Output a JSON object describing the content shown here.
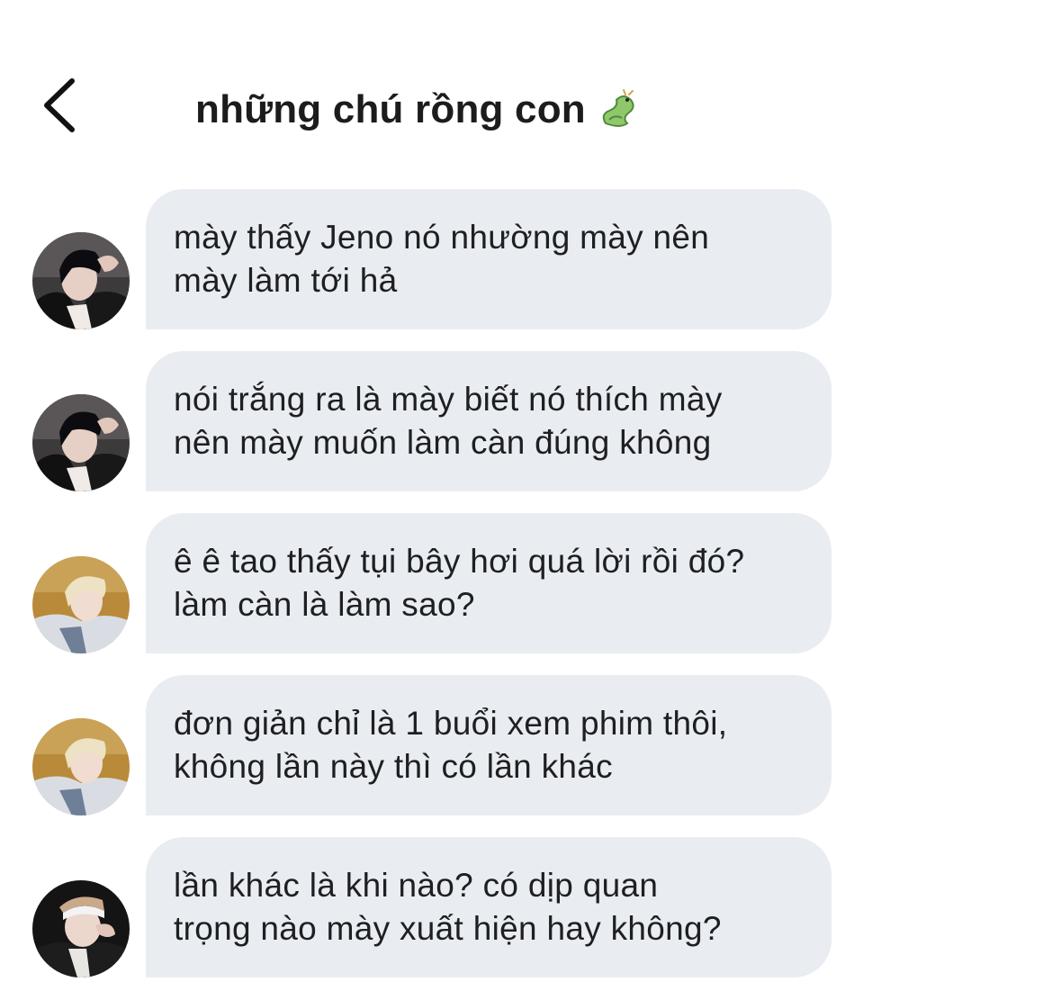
{
  "header": {
    "title": "những chú rồng con",
    "title_emoji": "dragon-emoji",
    "back_icon": "chevron-left-icon"
  },
  "colors": {
    "bubble_bg": "#e9ecf1",
    "text": "#1c1c1e",
    "background": "#ffffff"
  },
  "messages": [
    {
      "sender_avatar": "avatar-dark-hair",
      "text": "mày thấy Jeno nó nhường mày nên\nmày làm tới hả"
    },
    {
      "sender_avatar": "avatar-dark-hair",
      "text": "nói trắng ra là mày biết nó thích mày\nnên mày muốn làm càn đúng không"
    },
    {
      "sender_avatar": "avatar-blonde-hair",
      "text": "ê ê tao thấy tụi bây hơi quá lời rồi đó?\nlàm càn là làm sao?"
    },
    {
      "sender_avatar": "avatar-blonde-hair",
      "text": "đơn giản chỉ là 1 buổi xem phim thôi,\nkhông lần này thì có lần khác"
    },
    {
      "sender_avatar": "avatar-headband",
      "text": "lần khác là khi nào? có dịp quan\ntrọng nào mày xuất hiện hay không?"
    }
  ]
}
